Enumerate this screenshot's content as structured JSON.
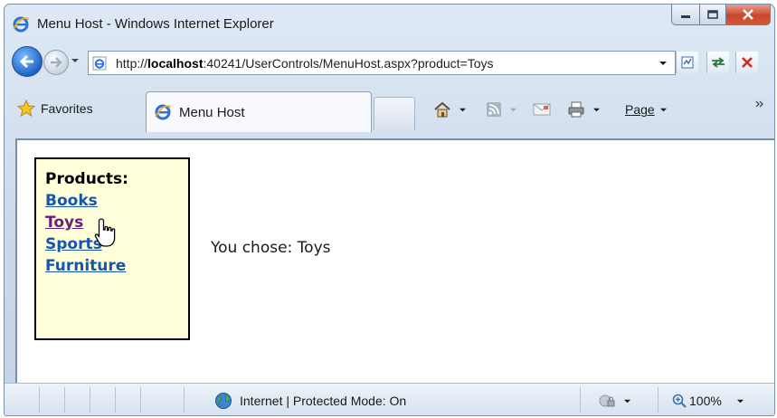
{
  "window": {
    "title": "Menu Host - Windows Internet Explorer"
  },
  "address": {
    "url_prefix": "http://",
    "url_host": "localhost",
    "url_rest": ":40241/UserControls/MenuHost.aspx?product=Toys"
  },
  "toolbar": {
    "favorites_label": "Favorites",
    "page_menu_label": "Page"
  },
  "tabs": [
    {
      "label": "Menu Host",
      "active": true
    }
  ],
  "page": {
    "menu": {
      "heading": "Products:",
      "items": [
        {
          "label": "Books"
        },
        {
          "label": "Toys"
        },
        {
          "label": "Sports"
        },
        {
          "label": "Furniture"
        }
      ]
    },
    "result_text": "You chose: Toys"
  },
  "status": {
    "zone_text": "Internet | Protected Mode: On",
    "zoom_text": "100%"
  },
  "icons": {
    "title": "ie-logo-icon",
    "back": "back-arrow-icon",
    "forward": "forward-arrow-icon",
    "favorites": "star-icon",
    "home": "home-icon",
    "feeds": "rss-feed-icon",
    "mail": "mail-icon",
    "print": "print-icon",
    "zone": "globe-icon",
    "zoom": "zoom-icon",
    "cursor": "hand-cursor-icon"
  },
  "colors": {
    "link": "#1555b0",
    "visited_link": "#6b1f79",
    "menu_background": "#ffffd9",
    "close_button": "#c9472a"
  }
}
